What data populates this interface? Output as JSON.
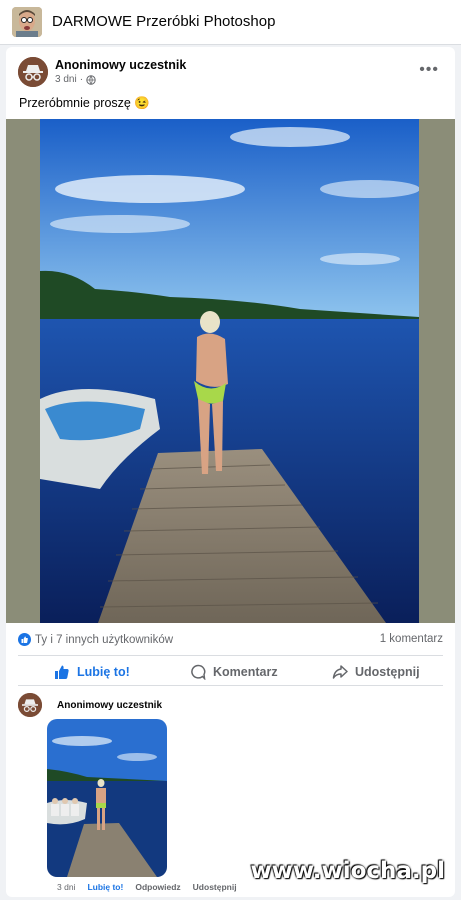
{
  "header": {
    "group_title": "DARMOWE Przeróbki Photoshop"
  },
  "post": {
    "author": "Anonimowy uczestnik",
    "time": "3 dni",
    "text": "Przeróbmnie proszę",
    "emoji": "😉"
  },
  "stats": {
    "reactions": "Ty i 7 innych użytkowników",
    "comments": "1 komentarz"
  },
  "actions": {
    "like": "Lubię to!",
    "comment": "Komentarz",
    "share": "Udostępnij"
  },
  "comment": {
    "author": "Anonimowy uczestnik",
    "time": "3 dni",
    "like": "Lubię to!",
    "reply": "Odpowiedz",
    "share": "Udostępnij"
  },
  "watermark": "www.wiocha.pl",
  "icons": [
    "globe-icon",
    "more-icon",
    "like-badge-icon",
    "thumbs-up-icon",
    "comment-icon",
    "share-icon",
    "incognito-avatar-icon"
  ],
  "colors": {
    "accent": "#1b74e4",
    "secondary_text": "#65676b",
    "background": "#f0f2f5"
  }
}
